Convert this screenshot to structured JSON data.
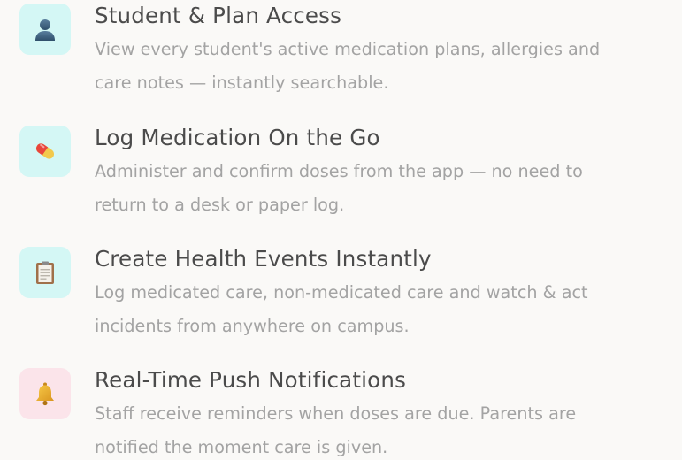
{
  "features": [
    {
      "icon": "person-icon",
      "icon_bg": "#d4f7f5",
      "title": "Student & Plan Access",
      "desc_line1": "View every student's active medication plans, allergies and",
      "desc_line2": "care notes — instantly searchable."
    },
    {
      "icon": "pill-icon",
      "icon_bg": "#d4f7f5",
      "title": "Log Medication On the Go",
      "desc_line1": "Administer and confirm doses from the app — no need to",
      "desc_line2": "return to a desk or paper log."
    },
    {
      "icon": "clipboard-icon",
      "icon_bg": "#d4f7f5",
      "title": "Create Health Events Instantly",
      "desc_line1": "Log medicated care, non-medicated care and watch & act",
      "desc_line2": "incidents from anywhere on campus."
    },
    {
      "icon": "bell-icon",
      "icon_bg": "#fbe4ea",
      "title": "Real-Time Push Notifications",
      "desc_line1": "Staff receive reminders when doses are due. Parents are",
      "desc_line2": "notified the moment care is given."
    }
  ]
}
